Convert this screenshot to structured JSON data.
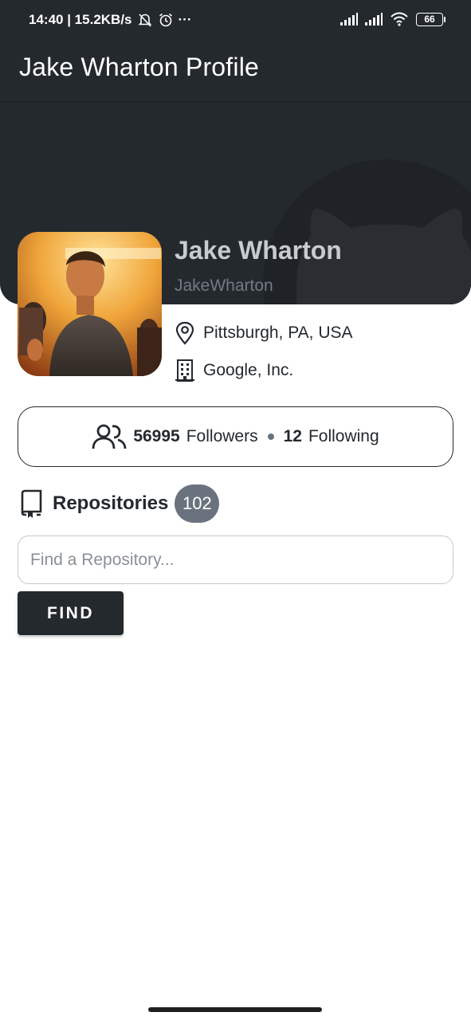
{
  "status_bar": {
    "time_speed": "14:40 | 15.2KB/s",
    "more": "···",
    "battery": "66",
    "icons": [
      "mute-bell-icon",
      "alarm-icon",
      "signal-icon",
      "signal-icon",
      "wifi-icon",
      "battery-icon"
    ]
  },
  "app_bar": {
    "title": "Jake Wharton Profile"
  },
  "profile": {
    "name": "Jake Wharton",
    "login": "JakeWharton",
    "location": "Pittsburgh, PA, USA",
    "company": "Google, Inc."
  },
  "stats": {
    "followers_count": "56995",
    "followers_label": "Followers",
    "following_count": "12",
    "following_label": "Following"
  },
  "repositories": {
    "title": "Repositories",
    "count": "102",
    "search_placeholder": "Find a Repository...",
    "search_value": "",
    "find_label": "FIND"
  },
  "colors": {
    "header": "#24292e",
    "badge": "#6a737d",
    "name": "#c8ccd1",
    "login": "#737a82"
  }
}
